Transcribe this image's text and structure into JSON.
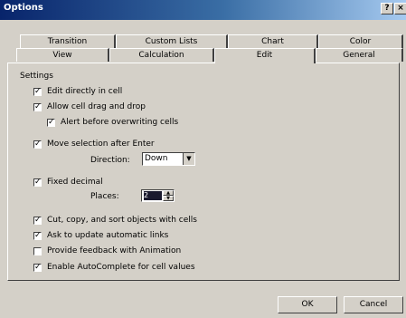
{
  "window": {
    "title": "Options",
    "help_glyph": "?",
    "close_glyph": "×"
  },
  "tabs_row1": [
    "Transition",
    "Custom Lists",
    "Chart",
    "Color"
  ],
  "tabs_row2": [
    "View",
    "Calculation",
    "Edit",
    "General"
  ],
  "active_tab": "Edit",
  "settings": {
    "group_label": "Settings",
    "edit_directly": {
      "label": "Edit directly in cell",
      "checked": true
    },
    "allow_drag": {
      "label": "Allow cell drag and drop",
      "checked": true
    },
    "alert_overwrite": {
      "label": "Alert before overwriting cells",
      "checked": true
    },
    "move_selection": {
      "label": "Move selection after Enter",
      "checked": true
    },
    "direction_label": "Direction:",
    "direction_value": "Down",
    "fixed_decimal": {
      "label": "Fixed decimal",
      "checked": true
    },
    "places_label": "Places:",
    "places_value": "2",
    "cut_copy_sort": {
      "label": "Cut, copy, and sort objects with cells",
      "checked": true
    },
    "ask_update": {
      "label": "Ask to update automatic links",
      "checked": true
    },
    "provide_feedback": {
      "label": "Provide feedback with Animation",
      "checked": false
    },
    "autocomplete": {
      "label": "Enable AutoComplete for cell values",
      "checked": true
    }
  },
  "buttons": {
    "ok": "OK",
    "cancel": "Cancel"
  }
}
